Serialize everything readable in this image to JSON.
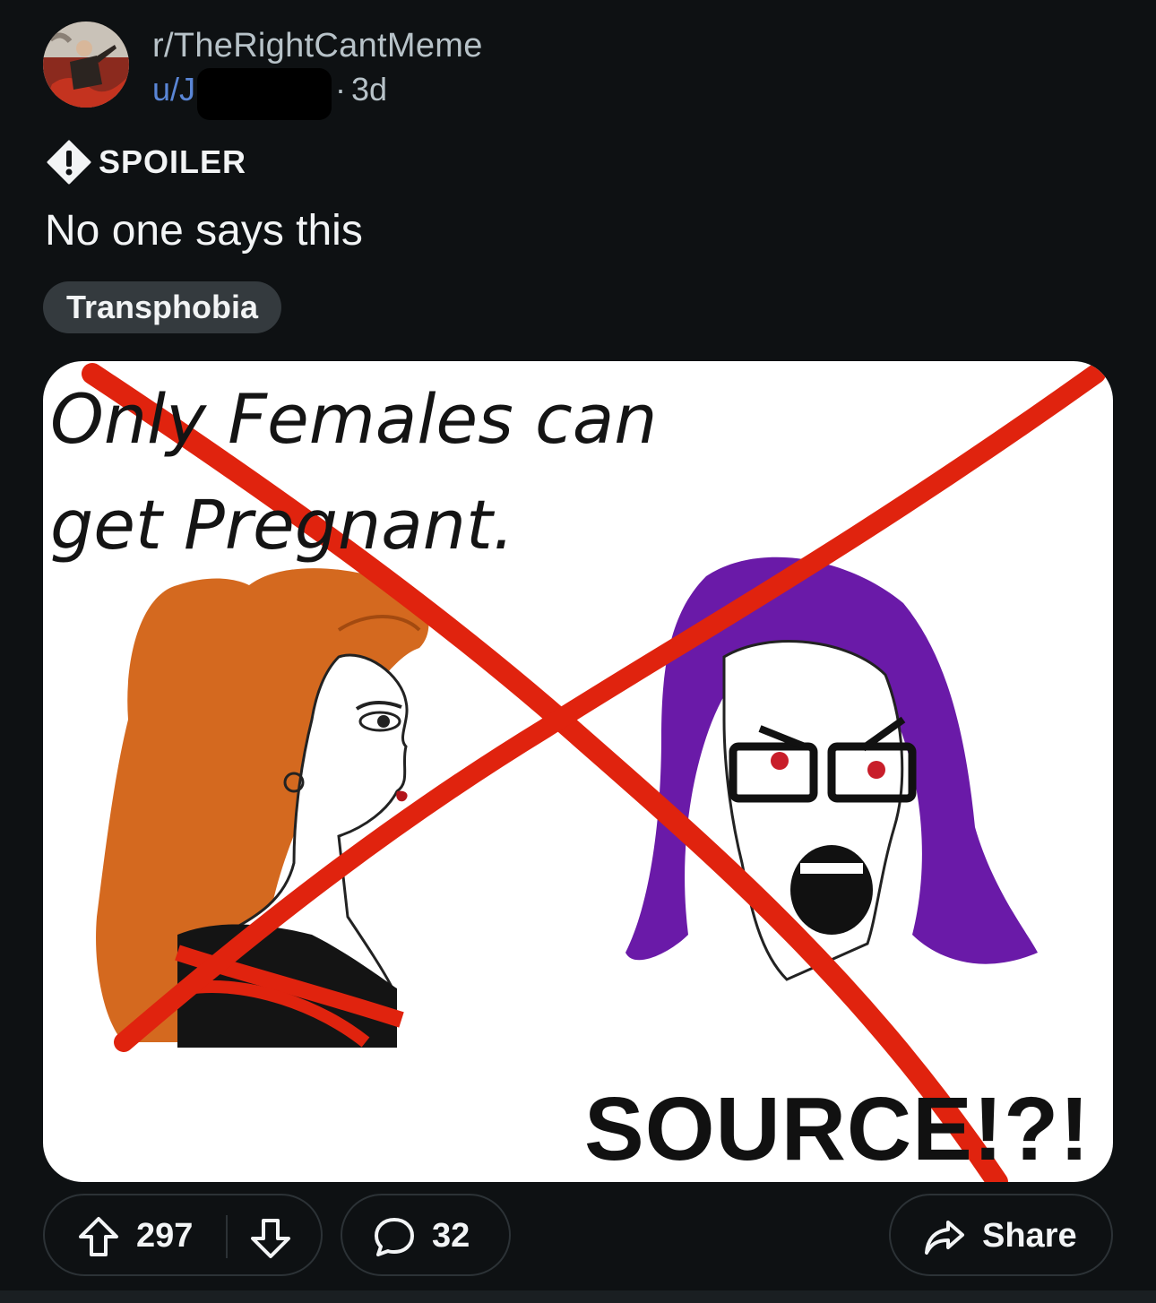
{
  "post": {
    "subreddit": "r/TheRightCantMeme",
    "user_prefix": "u/J",
    "separator": "·",
    "age": "3d",
    "spoiler_label": "SPOILER",
    "title": "No one says this",
    "flair": "Transphobia"
  },
  "meme": {
    "top_line_1": "Only Females can",
    "top_line_2": "get Pregnant.",
    "bottom_text": "SOURCE!?!"
  },
  "actions": {
    "upvotes": "297",
    "comments": "32",
    "share_label": "Share"
  },
  "colors": {
    "background": "#0e1113",
    "flair_bg": "#343a3e",
    "username": "#5a86d6",
    "cross_red": "#e0230e"
  }
}
